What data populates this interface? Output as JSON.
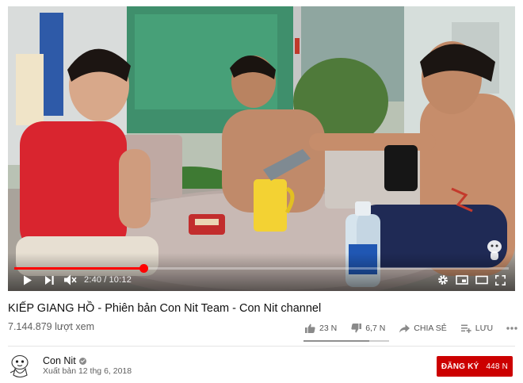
{
  "player": {
    "current_time": "2:40",
    "duration": "10:12",
    "progress": 0.2614
  },
  "video": {
    "title": "KIẾP GIANG HỒ - Phiên bản Con Nit Team - Con Nit channel",
    "views": "7.144.879 lượt xem"
  },
  "actions": {
    "like_count": "23 N",
    "dislike_count": "6,7 N",
    "share_label": "CHIA SẺ",
    "save_label": "LƯU"
  },
  "sentiment": {
    "like_ratio": 0.77
  },
  "channel": {
    "name": "Con Nit",
    "published": "Xuất bản 12 thg 6, 2018",
    "subscribe_label": "ĐĂNG KÝ",
    "subscriber_count": "448 N"
  },
  "colors": {
    "accent": "#ff0000",
    "subscribe_bg": "#cc0000"
  },
  "icons": [
    "play-icon",
    "next-icon",
    "mute-icon",
    "settings-icon",
    "miniplayer-icon",
    "theater-icon",
    "fullscreen-icon",
    "thumbs-up-icon",
    "thumbs-down-icon",
    "share-icon",
    "add-to-playlist-icon",
    "more-icon",
    "verified-icon"
  ]
}
